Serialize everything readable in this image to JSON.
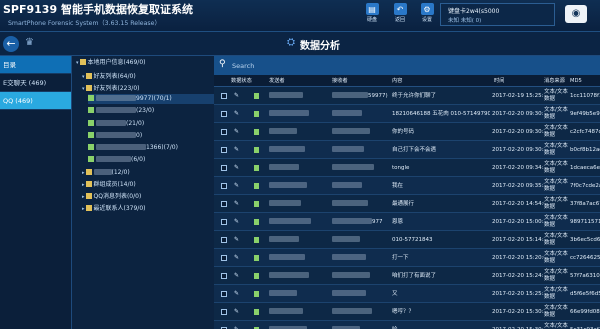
{
  "header": {
    "title": "SPF9139 智能手机数据恢复取证系统",
    "subtitle": "SmartPhone Forensic System（3.63.15 Release）",
    "buttons": [
      {
        "label": "硬盘",
        "icon": "hard-disk-icon"
      },
      {
        "label": "返回",
        "icon": "back-icon"
      },
      {
        "label": "设置",
        "icon": "settings-icon"
      }
    ],
    "device": {
      "name": "键盘卡2w4(s5000",
      "status": "未知  未知(  0)"
    },
    "camera_icon": "camera-icon"
  },
  "toolbar": {
    "page_title": "数据分析"
  },
  "left_tabs": {
    "header": "目录",
    "items": [
      {
        "label": "E交聊天 (469)",
        "active": false
      },
      {
        "label": "QQ (469)",
        "active": true
      }
    ]
  },
  "tree": {
    "items": [
      {
        "label": "本地用户信息(469/0)",
        "level": 0
      },
      {
        "label": "好友列表(64/0)",
        "level": 1
      },
      {
        "label": "好友列表(223/0)",
        "level": 1
      },
      {
        "label": "9977)(70/1)",
        "level": 2
      },
      {
        "label": "(23/0)",
        "level": 2
      },
      {
        "label": "(21/0)",
        "level": 2
      },
      {
        "label": "0)",
        "level": 2
      },
      {
        "label": "1366)(7/0)",
        "level": 2
      },
      {
        "label": "(6/0)",
        "level": 2
      },
      {
        "label": "(12/0)",
        "level": 1
      },
      {
        "label": "群组成员(14/0)",
        "level": 1
      },
      {
        "label": "QQ消息列表(0/0)",
        "level": 1
      },
      {
        "label": "最近联系人(379/0)",
        "level": 1
      }
    ]
  },
  "search": {
    "placeholder": "Search"
  },
  "table": {
    "columns": [
      "数据状态",
      "发送者",
      "接收者",
      "内容",
      "时间",
      "消息来源",
      "MD5"
    ],
    "rows": [
      {
        "recv": "59977)",
        "content": "终于允许你们聊了",
        "time": "2017-02-19 15:25:10",
        "source": "文本/文本数据",
        "md5": "1cc11078f1c"
      },
      {
        "recv": "",
        "content": "18210646188 五花肉 010-57149790",
        "time": "2017-02-20 09:30:10",
        "source": "文本/文本数据",
        "md5": "9ef49b5e9ef"
      },
      {
        "recv": "",
        "content": "你的号码",
        "time": "2017-02-20 09:30:20",
        "source": "文本/文本数据",
        "md5": "c2cfc7487c1"
      },
      {
        "recv": "",
        "content": "自己打下会不会遇",
        "time": "2017-02-20 09:30:55",
        "source": "文本/文本数据",
        "md5": "b0cf8b12ae1"
      },
      {
        "recv": "",
        "content": "tongle",
        "time": "2017-02-20 09:34:32",
        "source": "文本/文本数据",
        "md5": "1dcaeca6e6f"
      },
      {
        "recv": "",
        "content": "我在",
        "time": "2017-02-20 09:35:22",
        "source": "文本/文本数据",
        "md5": "7f0c7cde2a8"
      },
      {
        "recv": "",
        "content": "最通展行",
        "time": "2017-02-20 14:54:00",
        "source": "文本/文本数据",
        "md5": "37f8a7ac674"
      },
      {
        "recv": "977",
        "content": "恩恩",
        "time": "2017-02-20 15:00:34",
        "source": "文本/文本数据",
        "md5": "98971157143"
      },
      {
        "recv": "",
        "content": "010-57721843",
        "time": "2017-02-20 15:14:50",
        "source": "文本/文本数据",
        "md5": "3b6ec5cd6cc"
      },
      {
        "recv": "",
        "content": "打一下",
        "time": "2017-02-20 15:20:02",
        "source": "文本/文本数据",
        "md5": "cc7264625152"
      },
      {
        "recv": "",
        "content": "咱们打了有面说了",
        "time": "2017-02-20 15:24:17",
        "source": "文本/文本数据",
        "md5": "57f7a631040"
      },
      {
        "recv": "",
        "content": "又",
        "time": "2017-02-20 15:25:39",
        "source": "文本/文本数据",
        "md5": "d5f6e5f6d5"
      },
      {
        "recv": "",
        "content": "嗯哼？？",
        "time": "2017-02-20 15:30:22",
        "source": "文本/文本数据",
        "md5": "66e99fd080"
      },
      {
        "recv": "",
        "content": "哈",
        "time": "2017-02-20 15:30:41",
        "source": "文本/文本数据",
        "md5": "5c31c93af7e"
      }
    ]
  },
  "colors": {
    "accent": "#2aa9e0",
    "header_bg": "#0f2e52",
    "search_bar": "#17508a"
  }
}
